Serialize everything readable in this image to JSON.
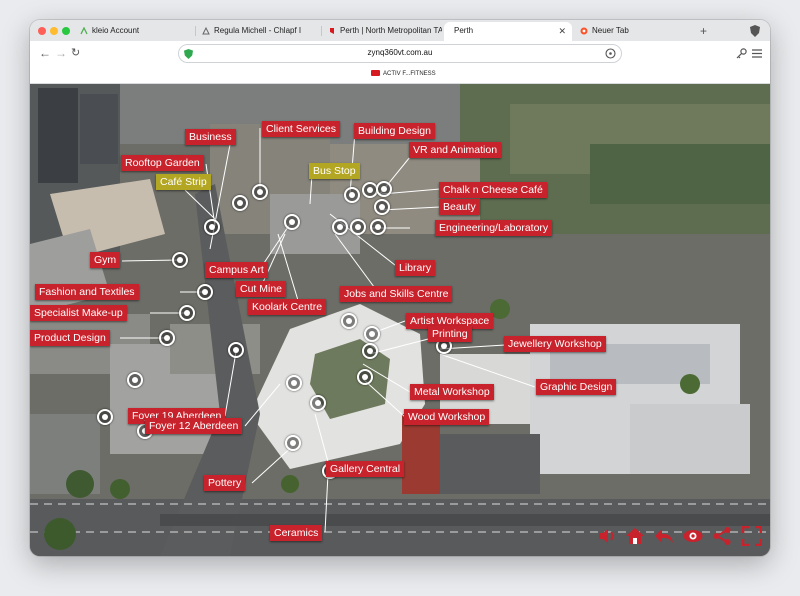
{
  "browser": {
    "tabs": [
      {
        "title": "kleio Account",
        "active": false
      },
      {
        "title": "Regula Michell - Chlapf I",
        "active": false
      },
      {
        "title": "Perth | North Metropolitan TAFE",
        "active": false
      },
      {
        "title": "Perth",
        "active": true
      },
      {
        "title": "Neuer Tab",
        "active": false
      }
    ],
    "new_tab_symbol": "+",
    "url": "zynq360vt.com.au",
    "bookmark_label": "ACTIV F...FITNESS"
  },
  "tour": {
    "labels": [
      {
        "text": "Business",
        "style": "red"
      },
      {
        "text": "Client Services",
        "style": "red"
      },
      {
        "text": "Building Design",
        "style": "red"
      },
      {
        "text": "Rooftop Garden",
        "style": "red"
      },
      {
        "text": "VR and Animation",
        "style": "red"
      },
      {
        "text": "Bus Stop",
        "style": "olive"
      },
      {
        "text": "Café Strip",
        "style": "olive"
      },
      {
        "text": "Chalk n Cheese Café",
        "style": "red"
      },
      {
        "text": "Beauty",
        "style": "red"
      },
      {
        "text": "Engineering/Laboratory",
        "style": "red"
      },
      {
        "text": "Gym",
        "style": "red"
      },
      {
        "text": "Campus Art",
        "style": "red"
      },
      {
        "text": "Library",
        "style": "red"
      },
      {
        "text": "Cut Mine",
        "style": "red"
      },
      {
        "text": "Fashion and Textiles",
        "style": "red"
      },
      {
        "text": "Jobs and Skills Centre",
        "style": "red"
      },
      {
        "text": "Koolark Centre",
        "style": "red"
      },
      {
        "text": "Specialist Make-up",
        "style": "red"
      },
      {
        "text": "Artist Workspace",
        "style": "red"
      },
      {
        "text": "Printing",
        "style": "red"
      },
      {
        "text": "Product Design",
        "style": "red"
      },
      {
        "text": "Jewellery Workshop",
        "style": "red"
      },
      {
        "text": "Graphic Design",
        "style": "red"
      },
      {
        "text": "Metal Workshop",
        "style": "red"
      },
      {
        "text": "Foyer 19 Aberdeen",
        "style": "red"
      },
      {
        "text": "Wood Workshop",
        "style": "red"
      },
      {
        "text": "Foyer 12 Aberdeen",
        "style": "red"
      },
      {
        "text": "Gallery Central",
        "style": "red"
      },
      {
        "text": "Pottery",
        "style": "red"
      },
      {
        "text": "Ceramics",
        "style": "red"
      }
    ],
    "controls": [
      "sound-icon",
      "home-icon",
      "back-icon",
      "view-icon",
      "share-icon",
      "fullscreen-icon"
    ],
    "accent_color": "#c8232c",
    "olive_color": "#b3a623"
  }
}
